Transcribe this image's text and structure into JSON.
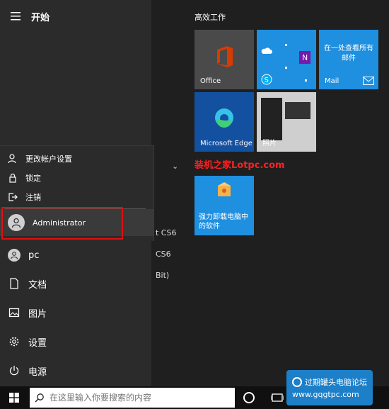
{
  "start": {
    "title": "开始"
  },
  "flyout": {
    "change_account": "更改帐户设置",
    "lock": "锁定",
    "signout": "注销",
    "admin": "Administrator"
  },
  "nav": {
    "user": "pc",
    "documents": "文档",
    "pictures": "图片",
    "settings": "设置",
    "power": "电源"
  },
  "partials": [
    "t CS6",
    "CS6",
    "Bit)"
  ],
  "tiles": {
    "group_title": "高效工作",
    "office": "Office",
    "mail_info": "在一处查看所有邮件",
    "mail": "Mail",
    "edge": "Microsoft Edge",
    "photos": "照片",
    "uninstall": "强力卸载电脑中的软件"
  },
  "watermark": "装机之家Lotpc.com",
  "taskbar": {
    "search_placeholder": "在这里输入你要搜索的内容",
    "forum_name": "过期罐头电脑论坛",
    "forum_url": "www.gqgtpc.com"
  },
  "colors": {
    "tile_blue": "#1f8fe0",
    "highlight_red": "#e01010",
    "office_red": "#d83b01"
  }
}
